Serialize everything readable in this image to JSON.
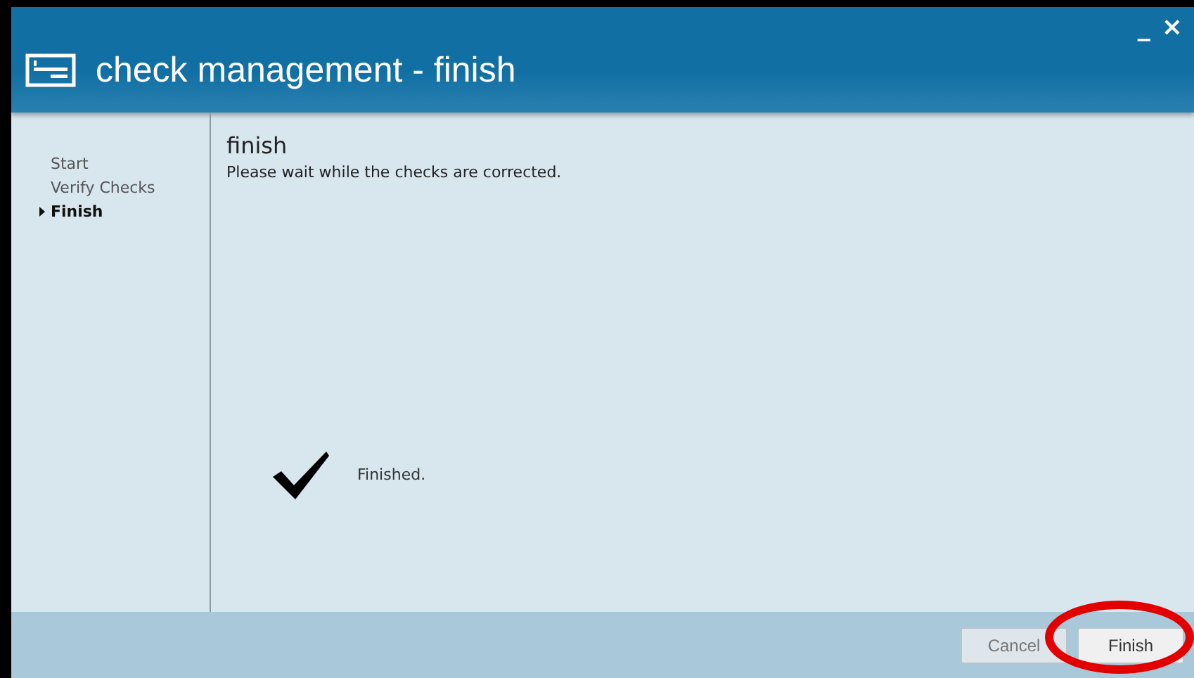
{
  "window": {
    "title": "check management - finish",
    "controls": [
      "_",
      "×"
    ]
  },
  "steps": [
    {
      "label": "Start",
      "selected": false
    },
    {
      "label": "Verify Checks",
      "selected": false
    },
    {
      "label": "Finish",
      "selected": true
    }
  ],
  "page": {
    "heading": "finish",
    "message": "Please wait while the checks are corrected.",
    "status": "Finished."
  },
  "buttons": [
    {
      "label": "Cancel",
      "disabled": true,
      "highlighted": false
    },
    {
      "label": "Finish",
      "disabled": false,
      "highlighted": true
    }
  ]
}
